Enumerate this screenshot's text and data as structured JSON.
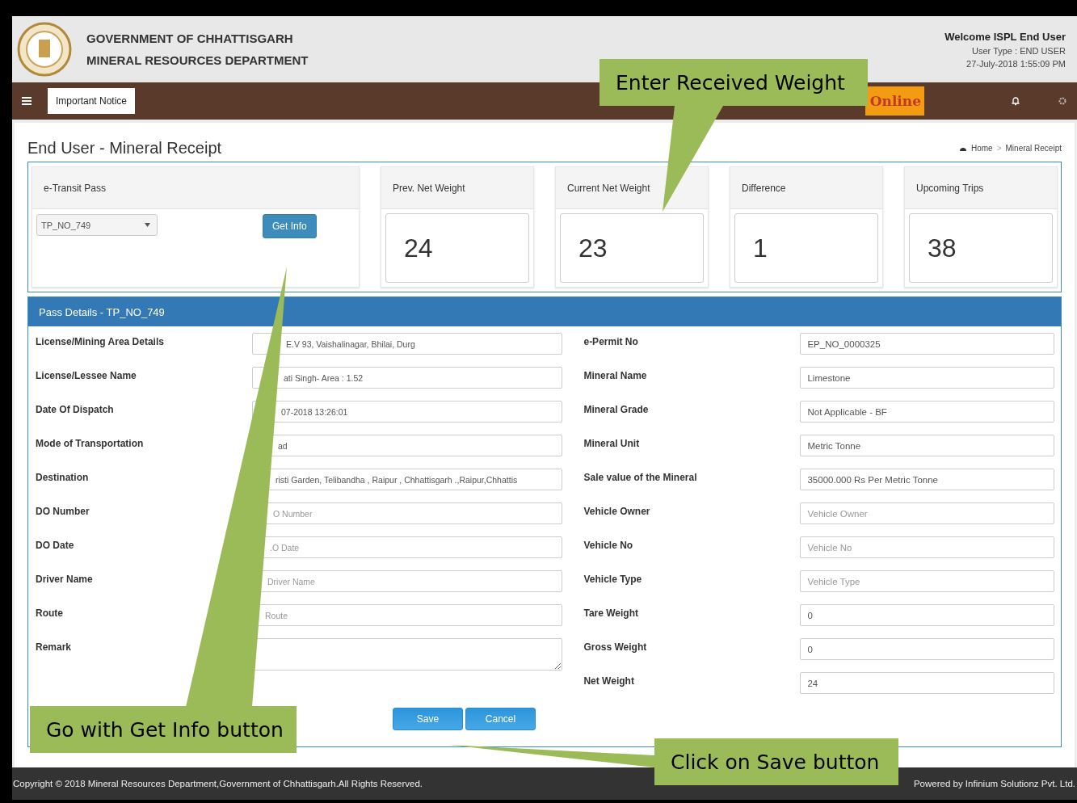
{
  "header": {
    "title": "GOVERNMENT OF CHHATTISGARH",
    "subtitle": "MINERAL RESOURCES DEPARTMENT",
    "welcome": "Welcome ISPL End User",
    "user_type": "User Type : END USER",
    "datetime": "27-July-2018 1:55:09 PM"
  },
  "navbar": {
    "notice_button": "Important Notice",
    "logo_text": "Online"
  },
  "page": {
    "title": "End User - Mineral Receipt",
    "breadcrumb": [
      "Home",
      "Mineral Receipt"
    ],
    "separator": ">"
  },
  "transit": {
    "label": "e-Transit Pass",
    "selected_pass": "TP_NO_749",
    "button": "Get Info"
  },
  "stats": [
    {
      "label": "Prev. Net Weight",
      "value": "24"
    },
    {
      "label": "Current Net Weight",
      "value": "23"
    },
    {
      "label": "Difference",
      "value": "1"
    },
    {
      "label": "Upcoming Trips",
      "value": "38"
    }
  ],
  "pass_details": {
    "title": "Pass Details - TP_NO_749",
    "left_fields": [
      {
        "label": "License/Mining Area Details",
        "kind": "input",
        "value": "E.V 93, Vaishalinagar, Bhilai, Durg"
      },
      {
        "label": "License/Lessee Name",
        "kind": "input",
        "value": "ati Singh- Area : 1.52"
      },
      {
        "label": "Date Of Dispatch",
        "kind": "input",
        "value": "07-2018 13:26:01"
      },
      {
        "label": "Mode of Transportation",
        "kind": "input",
        "value": "ad"
      },
      {
        "label": "Destination",
        "kind": "input",
        "value": "risti Garden, Telibandha , Raipur , Chhattisgarh .,Raipur,Chhattis"
      },
      {
        "label": "DO Number",
        "kind": "input",
        "placeholder": "O Number"
      },
      {
        "label": "DO Date",
        "kind": "input",
        "placeholder": ".O Date"
      },
      {
        "label": "Driver Name",
        "kind": "input",
        "placeholder": "Driver Name"
      },
      {
        "label": "Route",
        "kind": "input",
        "placeholder": "Route"
      },
      {
        "label": "Remark",
        "kind": "textarea"
      }
    ],
    "right_fields": [
      {
        "label": "e-Permit No",
        "kind": "input",
        "value": "EP_NO_0000325"
      },
      {
        "label": "Mineral Name",
        "kind": "input",
        "value": "Limestone"
      },
      {
        "label": "Mineral Grade",
        "kind": "input",
        "value": "Not Applicable - BF"
      },
      {
        "label": "Mineral Unit",
        "kind": "input",
        "value": "Metric Tonne"
      },
      {
        "label": "Sale value of the Mineral",
        "kind": "input",
        "value": "35000.000 Rs Per Metric Tonne"
      },
      {
        "label": "Vehicle Owner",
        "kind": "input",
        "placeholder": "Vehicle Owner"
      },
      {
        "label": "Vehicle No",
        "kind": "input",
        "placeholder": "Vehicle No"
      },
      {
        "label": "Vehicle Type",
        "kind": "input",
        "placeholder": "Vehicle Type"
      },
      {
        "label": "Tare Weight",
        "kind": "input",
        "value": "0"
      },
      {
        "label": "Gross Weight",
        "kind": "input",
        "value": "0"
      },
      {
        "label": "Net Weight",
        "kind": "input",
        "value": "24"
      }
    ],
    "buttons": [
      "Save",
      "Cancel"
    ]
  },
  "footer": {
    "copyright": "Copyright © 2018 Mineral Resources Department,Government of Chhattisgarh.All Rights Reserved.",
    "powered": "Powered by Infinium Solutionz Pvt. Ltd."
  },
  "callouts": [
    {
      "kind": "top",
      "text": "Enter Received Weight"
    },
    {
      "kind": "left",
      "text": "Go with Get Info button"
    },
    {
      "kind": "bottom",
      "text": "Click on Save button"
    }
  ]
}
